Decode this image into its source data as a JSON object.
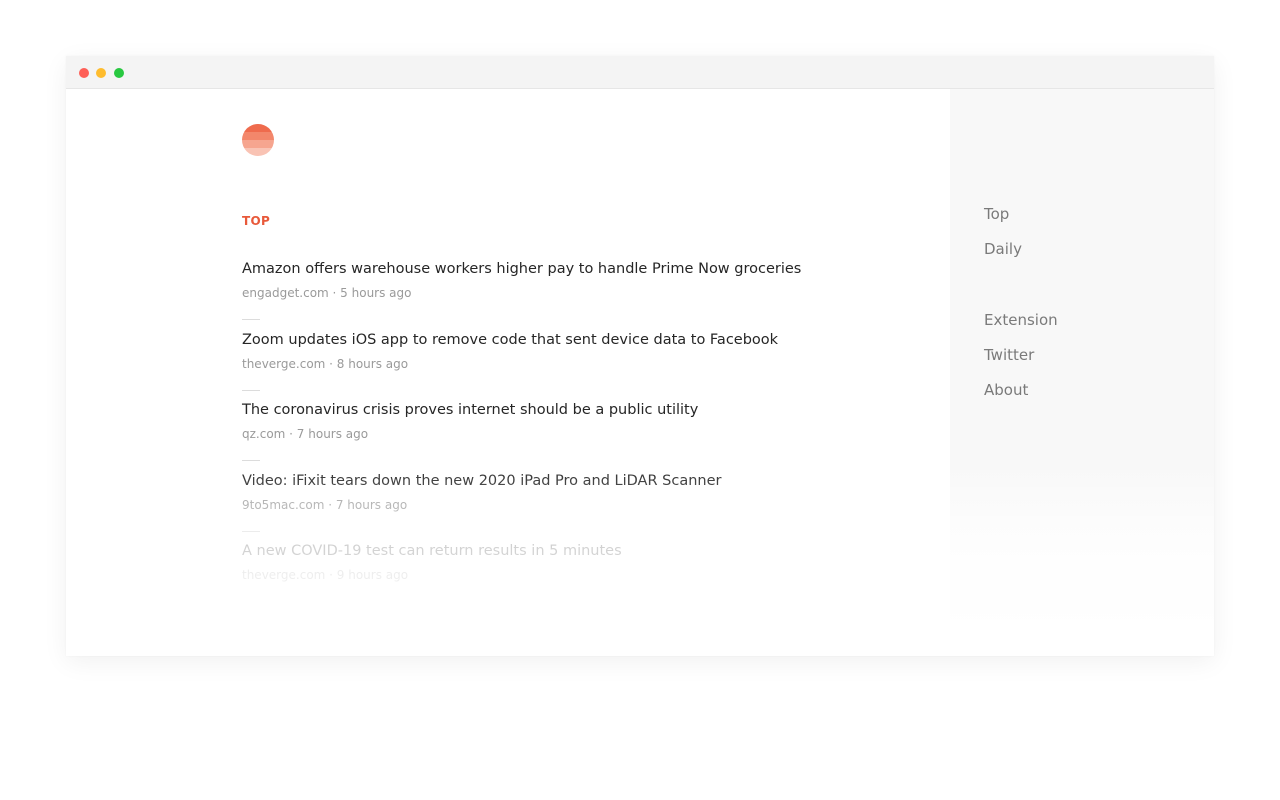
{
  "window": {
    "traffic_lights": [
      {
        "name": "close",
        "color": "#fe5f57"
      },
      {
        "name": "minimize",
        "color": "#febc2e"
      },
      {
        "name": "zoom",
        "color": "#28c840"
      }
    ]
  },
  "logo": {
    "icon": "striped-sun-logo-icon",
    "stripe_colors": [
      "#ef6b4d",
      "#f3876b",
      "#f6a58f",
      "#f9c3b4"
    ]
  },
  "section": {
    "label": "TOP",
    "accent_color": "#e8593a"
  },
  "stories": [
    {
      "title": "Amazon offers warehouse workers higher pay to handle Prime Now groceries",
      "meta": "engadget.com · 5 hours ago"
    },
    {
      "title": "Zoom updates iOS app to remove code that sent device data to Facebook",
      "meta": "theverge.com · 8 hours ago"
    },
    {
      "title": "The coronavirus crisis proves internet should be a public utility",
      "meta": "qz.com · 7 hours ago"
    },
    {
      "title": "Video: iFixit tears down the new 2020 iPad Pro and LiDAR Scanner",
      "meta": "9to5mac.com · 7 hours ago"
    },
    {
      "title": "A new COVID-19 test can return results in 5 minutes",
      "meta": "theverge.com · 9 hours ago"
    }
  ],
  "sidebar": {
    "primary_links": [
      {
        "label": "Top"
      },
      {
        "label": "Daily"
      }
    ],
    "secondary_links": [
      {
        "label": "Extension"
      },
      {
        "label": "Twitter"
      },
      {
        "label": "About"
      }
    ]
  }
}
